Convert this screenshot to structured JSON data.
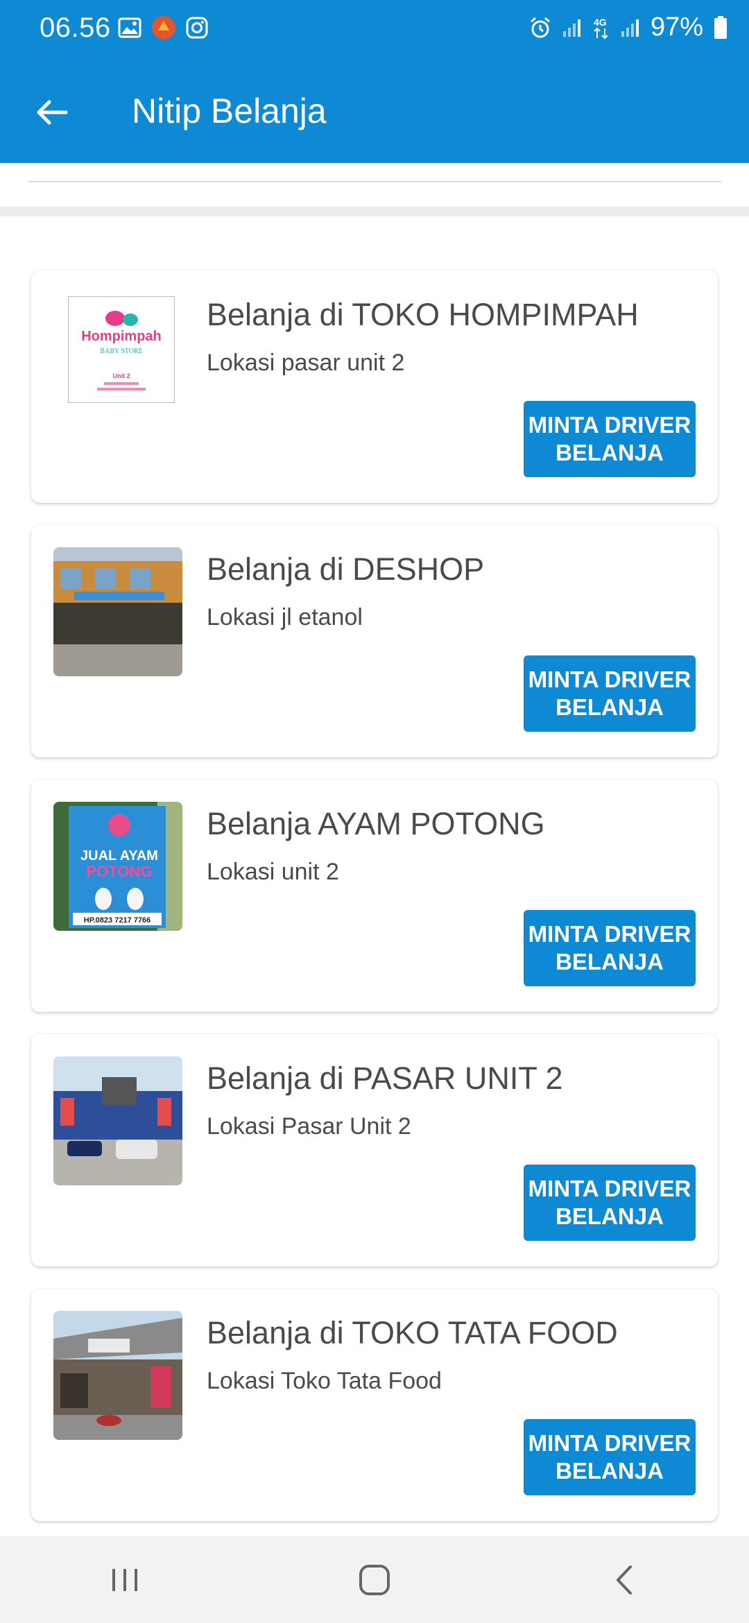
{
  "status": {
    "time": "06.56",
    "battery": "97%",
    "icons": [
      "gallery-icon",
      "app-notification-icon",
      "instagram-icon",
      "alarm-icon",
      "signal-icon",
      "4g-icon",
      "signal-icon",
      "battery-icon"
    ]
  },
  "appbar": {
    "title": "Nitip Belanja",
    "back_icon": "back-arrow-icon"
  },
  "stores": [
    {
      "title": "Belanja di TOKO HOMPIMPAH",
      "location": "Lokasi pasar unit 2",
      "button_line1": "MINTA DRIVER",
      "button_line2": "BELANJA",
      "logo_name": "Hompimpah",
      "logo_sub": "BABY STORE",
      "logo_unit": "Unit 2"
    },
    {
      "title": "Belanja di DESHOP",
      "location": "Lokasi jl etanol",
      "button_line1": "MINTA DRIVER",
      "button_line2": "BELANJA"
    },
    {
      "title": "Belanja AYAM POTONG",
      "location": "Lokasi unit 2",
      "button_line1": "MINTA DRIVER",
      "button_line2": "BELANJA",
      "banner_line1": "JUAL AYAM",
      "banner_line2": "POTONG",
      "banner_phone": "HP.0823 7217 7766"
    },
    {
      "title": "Belanja di PASAR UNIT 2",
      "location": "Lokasi Pasar Unit 2",
      "button_line1": "MINTA DRIVER",
      "button_line2": "BELANJA"
    },
    {
      "title": "Belanja di TOKO TATA FOOD",
      "location": "Lokasi Toko Tata Food",
      "button_line1": "MINTA DRIVER",
      "button_line2": "BELANJA"
    }
  ],
  "colors": {
    "primary": "#0e8ad4",
    "text": "#4a4a4a",
    "nav_bg": "#f2f2f2"
  },
  "navbar": {
    "icons": [
      "recent-apps-icon",
      "home-icon",
      "nav-back-icon"
    ]
  }
}
